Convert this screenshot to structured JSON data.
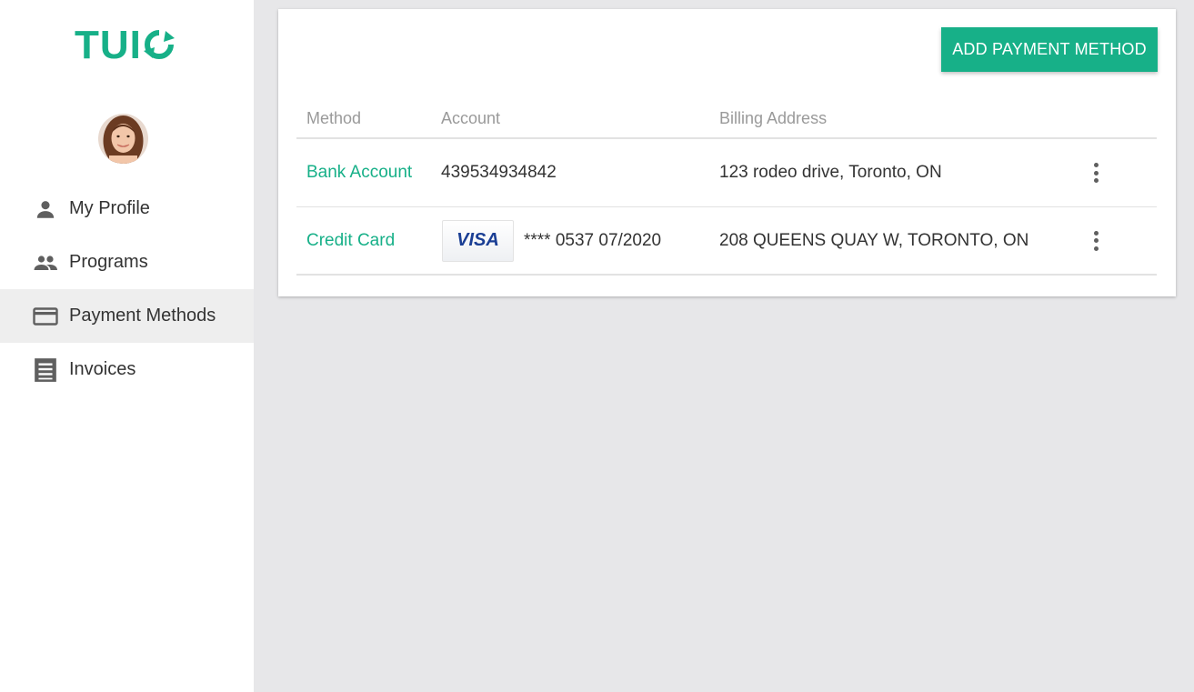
{
  "brand": {
    "logo_text": "TUI",
    "accent_color": "#17b088"
  },
  "sidebar": {
    "items": [
      {
        "label": "My Profile",
        "icon": "person-icon",
        "active": false
      },
      {
        "label": "Programs",
        "icon": "people-icon",
        "active": false
      },
      {
        "label": "Payment Methods",
        "icon": "credit-card-icon",
        "active": true
      },
      {
        "label": "Invoices",
        "icon": "receipt-icon",
        "active": false
      }
    ]
  },
  "main": {
    "add_button_label": "ADD PAYMENT METHOD",
    "table": {
      "headers": {
        "method": "Method",
        "account": "Account",
        "address": "Billing Address"
      },
      "rows": [
        {
          "method": "Bank Account",
          "account": "439534934842",
          "card_brand": "",
          "address": "123 rodeo drive, Toronto, ON"
        },
        {
          "method": "Credit Card",
          "account": "**** 0537 07/2020",
          "card_brand": "VISA",
          "address": "208 QUEENS QUAY W, TORONTO, ON"
        }
      ]
    }
  }
}
